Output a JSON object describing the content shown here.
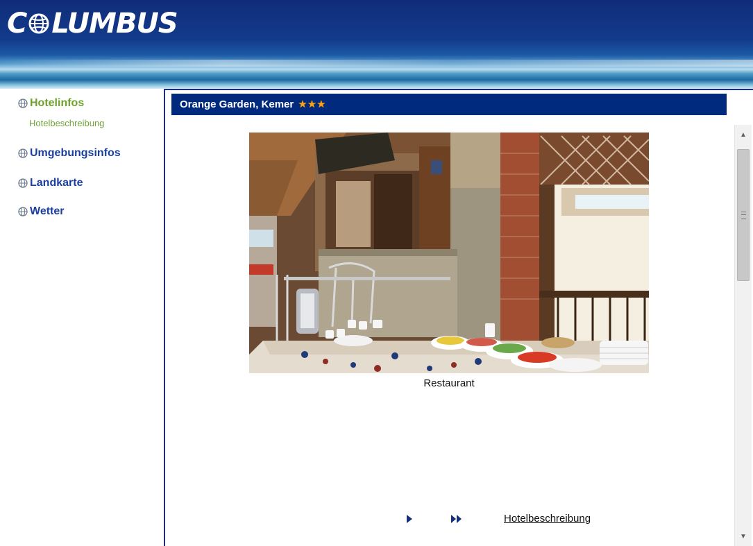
{
  "header": {
    "logo_text_left": "C",
    "logo_text_right": "LUMBUS"
  },
  "sidebar": {
    "items": [
      {
        "label": "Hotelinfos",
        "icon": "globe-icon",
        "active": true
      },
      {
        "label": "Umgebungsinfos",
        "icon": "globe-icon",
        "active": false
      },
      {
        "label": "Landkarte",
        "icon": "globe-icon",
        "active": false
      },
      {
        "label": "Wetter",
        "icon": "globe-icon",
        "active": false
      }
    ],
    "subitem": {
      "label": "Hotelbeschreibung"
    }
  },
  "main": {
    "title": "Orange Garden, Kemer",
    "star_rating": 3,
    "star_glyph": "★",
    "photo_caption": "Restaurant",
    "next_icon": "play-icon",
    "last_icon": "fast-forward-icon",
    "bottom_link": "Hotelbeschreibung"
  },
  "colors": {
    "header_dark": "#102c78",
    "title_bar": "#002a7e",
    "nav_blue": "#1b3fa0",
    "nav_active_green": "#6ea12b",
    "star_orange": "#f7a21b"
  }
}
